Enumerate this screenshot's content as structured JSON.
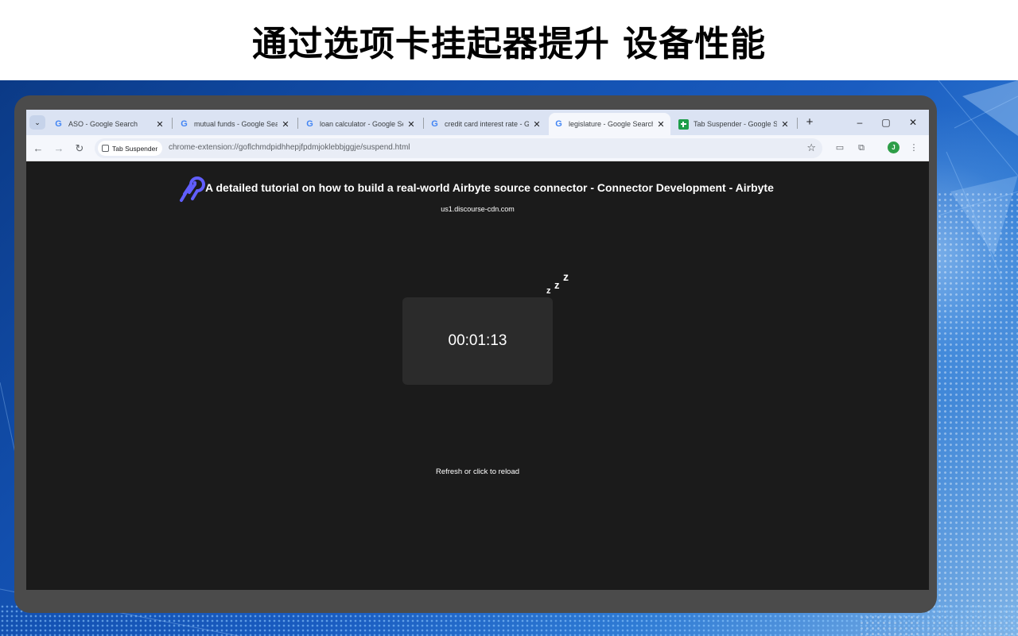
{
  "banner": {
    "title": "通过选项卡挂起器提升 设备性能"
  },
  "browser": {
    "tab_search_icon": "chevron-down-icon",
    "tabs": [
      {
        "label": "ASO - Google Search",
        "icon": "google-icon",
        "active": false
      },
      {
        "label": "mutual funds - Google Sea",
        "icon": "google-icon",
        "active": false
      },
      {
        "label": "loan calculator - Google Se",
        "icon": "google-icon",
        "active": false
      },
      {
        "label": "credit card interest rate - G",
        "icon": "google-icon",
        "active": false
      },
      {
        "label": "legislature - Google Search",
        "icon": "google-icon",
        "active": true
      },
      {
        "label": "Tab Suspender - Google Sh",
        "icon": "sheets-icon",
        "active": false
      }
    ],
    "new_tab": "+",
    "window_controls": {
      "minimize": "–",
      "restore": "▢",
      "close": "✕"
    },
    "address": {
      "chip_label": "Tab Suspender",
      "url": "chrome-extension://goflchmdpidhhepjfpdmjoklebbjggje/suspend.html"
    },
    "avatar_initial": "J"
  },
  "suspended_page": {
    "title": "A detailed tutorial on how to build a real-world Airbyte source connector - Connector Development - Airbyte",
    "domain": "us1.discourse-cdn.com",
    "sleep_glyphs": [
      "z",
      "z",
      "z"
    ],
    "timer": "00:01:13",
    "reload_hint": "Refresh or click to reload"
  },
  "colors": {
    "banner_bg": "#ffffff",
    "page_bg": "#1b1b1b",
    "timer_box": "#2b2b2b",
    "logo": "#615eff",
    "tab_strip": "#dbe3f3",
    "frame": "#4b4b4b"
  }
}
